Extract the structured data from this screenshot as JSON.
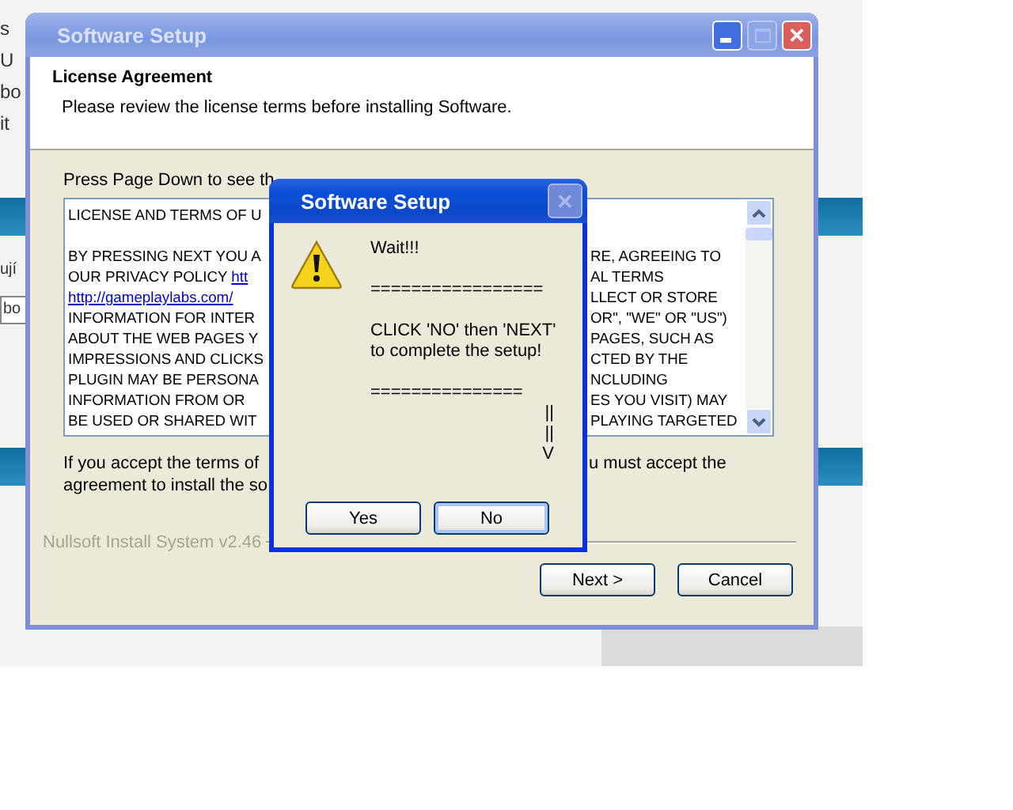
{
  "background_page": {
    "fragments": [
      {
        "text": "s",
        "kind": "line"
      },
      {
        "text": "U",
        "kind": "line"
      },
      {
        "text": "bo",
        "kind": "line"
      },
      {
        "text": "it",
        "kind": "line"
      },
      {
        "text": "ují",
        "kind": "row"
      },
      {
        "text": "bo",
        "kind": "field"
      }
    ]
  },
  "setup_window": {
    "title": "Software Setup",
    "active": false,
    "close_glyph": "✕",
    "header": {
      "title": "License Agreement",
      "subtitle": "Please review the license terms before installing Software."
    },
    "instruction": "Press Page Down to see th",
    "license_lines": [
      {
        "kind": "text",
        "left": "LICENSE AND TERMS OF U"
      },
      {
        "kind": "blank"
      },
      {
        "kind": "text",
        "left": "BY PRESSING NEXT YOU A",
        "right": "RE, AGREEING TO"
      },
      {
        "kind": "text",
        "left": "OUR PRIVACY POLICY ",
        "link": "htt",
        "right": "AL TERMS"
      },
      {
        "kind": "text",
        "link": "http://gameplaylabs.com/",
        "right": "LLECT OR STORE"
      },
      {
        "kind": "text",
        "left": "INFORMATION FOR INTER",
        "right": "OR\", \"WE\" OR \"US\")"
      },
      {
        "kind": "text",
        "left": "ABOUT THE WEB PAGES Y",
        "right": "PAGES, SUCH AS"
      },
      {
        "kind": "text",
        "left": "IMPRESSIONS AND CLICKS",
        "right": "CTED BY THE"
      },
      {
        "kind": "text",
        "left": "PLUGIN MAY BE PERSONA",
        "right": "NCLUDING"
      },
      {
        "kind": "text",
        "left": "INFORMATION FROM OR",
        "right": "ES YOU VISIT) MAY"
      },
      {
        "kind": "text",
        "left": "BE USED OR SHARED WIT",
        "right": "PLAYING TARGETED"
      }
    ],
    "accept_lines": [
      {
        "left": "If you accept the terms of",
        "right": "u must accept the"
      },
      {
        "left": "agreement to install the so"
      }
    ],
    "branding": "Nullsoft Install System v2.46",
    "buttons": [
      {
        "label": "Next >"
      },
      {
        "label": "Cancel"
      }
    ]
  },
  "message_box": {
    "title": "Software Setup",
    "active": true,
    "close_disabled": true,
    "close_glyph": "✕",
    "lines": [
      {
        "text": "Wait!!!",
        "kind": "text"
      },
      {
        "text": "=================",
        "kind": "text"
      },
      {
        "text": "CLICK 'NO' then 'NEXT'",
        "kind": "text"
      },
      {
        "text": "to complete the setup!",
        "kind": "tight"
      },
      {
        "text": "===============",
        "kind": "text"
      },
      {
        "text": "||",
        "kind": "arrow"
      },
      {
        "text": "||",
        "kind": "arrow"
      },
      {
        "text": "V",
        "kind": "arrow"
      }
    ],
    "buttons": [
      {
        "label": "Yes",
        "focused": false
      },
      {
        "label": "No",
        "focused": true
      }
    ]
  }
}
